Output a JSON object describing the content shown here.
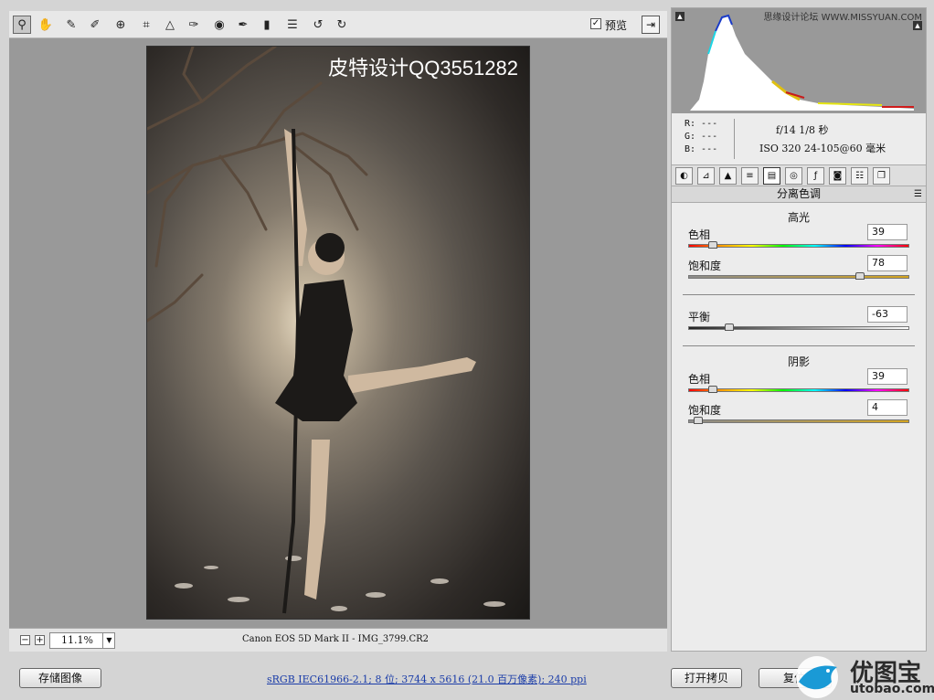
{
  "toolbar": {
    "tools": [
      "zoom-icon",
      "hand-icon",
      "white-balance-icon",
      "color-sampler-icon",
      "target-adjust-icon",
      "crop-icon",
      "straighten-icon",
      "spot-removal-icon",
      "red-eye-icon",
      "adjustment-brush-icon",
      "graduated-filter-icon",
      "preferences-icon",
      "rotate-ccw-icon",
      "rotate-cw-icon"
    ],
    "preview_checked": "✓",
    "preview_label": "预览"
  },
  "canvas": {
    "watermark": "皮特设计QQ3551282"
  },
  "zoombar": {
    "minus": "−",
    "plus": "+",
    "zoom_value": "11.1%",
    "camera_info": "Canon EOS 5D Mark II -  IMG_3799.CR2"
  },
  "histogram": {
    "site_text": "思缘设计论坛 WWW.MISSYUAN.COM"
  },
  "readout": {
    "r": "R:  ---",
    "g": "G:  ---",
    "b": "B:  ---",
    "exposure": "f/14   1/8 秒",
    "iso_lens": "ISO 320   24-105@60 毫米"
  },
  "panel": {
    "title": "分离色调",
    "highlights": {
      "title": "高光",
      "hue_label": "色相",
      "hue_value": "39",
      "hue_level": 0.108,
      "sat_label": "饱和度",
      "sat_value": "78",
      "sat_level": 0.78
    },
    "balance": {
      "label": "平衡",
      "value": "-63",
      "level": 0.185
    },
    "shadows": {
      "title": "阴影",
      "hue_label": "色相",
      "hue_value": "39",
      "hue_level": 0.108,
      "sat_label": "饱和度",
      "sat_value": "4",
      "sat_level": 0.04
    }
  },
  "bottombar": {
    "save_label": "存储图像",
    "workflow": "sRGB IEC61966-2.1; 8 位;  3744 x 5616 (21.0 百万像素); 240 ppi",
    "open_copy_label": "打开拷贝",
    "reset_label": "复位"
  },
  "logo": {
    "cn": "优图宝",
    "en": "utobao.com"
  }
}
